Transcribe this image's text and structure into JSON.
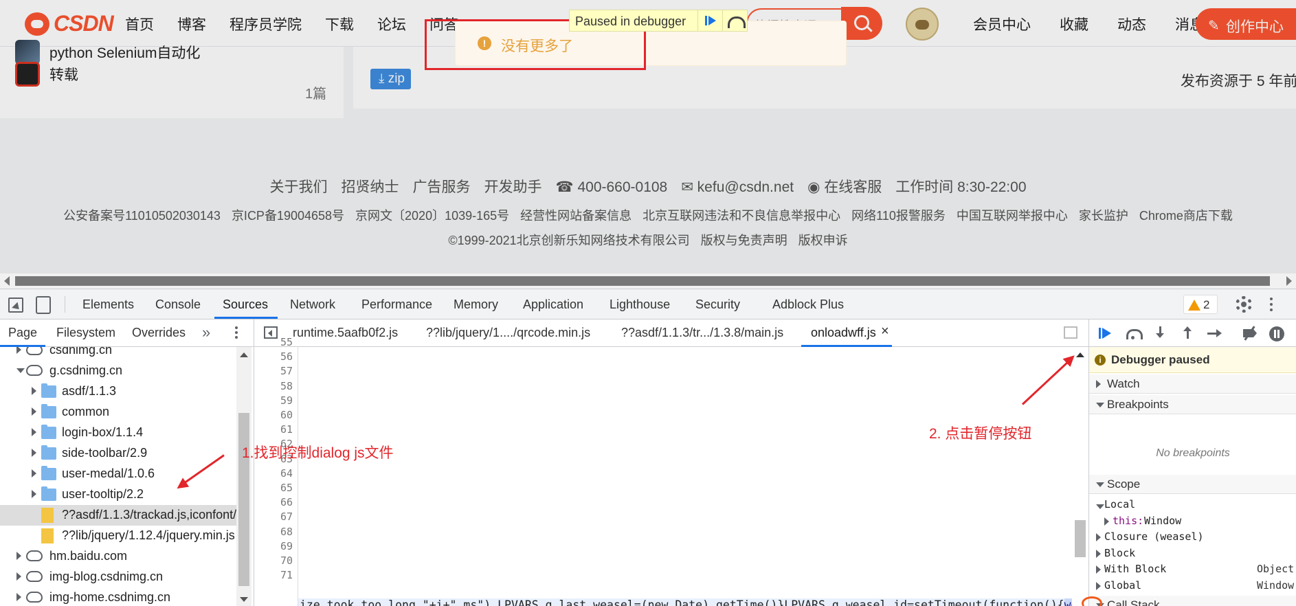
{
  "site": {
    "logo_text": "CSDN",
    "nav": [
      "首页",
      "博客",
      "程序员学院",
      "下载",
      "论坛",
      "问答"
    ],
    "search_placeholder": "热门搜索词",
    "nav_right": [
      "会员中心",
      "收藏",
      "动态",
      "消息"
    ],
    "create_button": "创作中心",
    "create_icon": "pen-icon",
    "paused_label": "Paused in debugger",
    "toast_text": "没有更多了",
    "toast_icon": "!",
    "sidebar_items": [
      {
        "label": "python Selenium自动化",
        "count": ""
      },
      {
        "label": "转载",
        "count": "1篇"
      }
    ],
    "zip_label": "zip",
    "zip_icon": "⤓",
    "publish_text": "发布资源于 5 年前",
    "footer_row1": [
      "关于我们",
      "招贤纳士",
      "广告服务",
      "开发助手",
      "☎ 400-660-0108",
      "✉ kefu@csdn.net",
      "◉ 在线客服",
      "工作时间 8:30-22:00"
    ],
    "footer_row2": [
      "公安备案号11010502030143",
      "京ICP备19004658号",
      "京网文〔2020〕1039-165号",
      "经营性网站备案信息",
      "北京互联网违法和不良信息举报中心",
      "网络110报警服务",
      "中国互联网举报中心",
      "家长监护",
      "Chrome商店下载"
    ],
    "footer_row3": [
      "©1999-2021北京创新乐知网络技术有限公司",
      "版权与免责声明",
      "版权申诉"
    ]
  },
  "devtools": {
    "tabs": [
      "Elements",
      "Console",
      "Sources",
      "Network",
      "Performance",
      "Memory",
      "Application",
      "Lighthouse",
      "Security",
      "Adblock Plus"
    ],
    "active_tab": "Sources",
    "warning_count": "2",
    "navigator_tabs": [
      "Page",
      "Filesystem",
      "Overrides"
    ],
    "more_tabs": "»",
    "tree": [
      {
        "label": "csdnimg.cn",
        "type": "cloud",
        "arrow": "r",
        "indent": 0
      },
      {
        "label": "g.csdnimg.cn",
        "type": "cloud",
        "arrow": "d",
        "indent": 0
      },
      {
        "label": "asdf/1.1.3",
        "type": "folder",
        "arrow": "r",
        "indent": 1
      },
      {
        "label": "common",
        "type": "folder",
        "arrow": "r",
        "indent": 1
      },
      {
        "label": "login-box/1.1.4",
        "type": "folder",
        "arrow": "r",
        "indent": 1
      },
      {
        "label": "side-toolbar/2.9",
        "type": "folder",
        "arrow": "r",
        "indent": 1
      },
      {
        "label": "user-medal/1.0.6",
        "type": "folder",
        "arrow": "r",
        "indent": 1
      },
      {
        "label": "user-tooltip/2.2",
        "type": "folder",
        "arrow": "r",
        "indent": 1
      },
      {
        "label": "??asdf/1.1.3/trackad.js,iconfont/",
        "type": "file",
        "arrow": "",
        "indent": 1,
        "selected": true
      },
      {
        "label": "??lib/jquery/1.12.4/jquery.min.js",
        "type": "file",
        "arrow": "",
        "indent": 1
      },
      {
        "label": "hm.baidu.com",
        "type": "cloud",
        "arrow": "r",
        "indent": 0
      },
      {
        "label": "img-blog.csdnimg.cn",
        "type": "cloud",
        "arrow": "r",
        "indent": 0
      },
      {
        "label": "img-home.csdnimg.cn",
        "type": "cloud",
        "arrow": "r",
        "indent": 0
      }
    ],
    "editor_tabs": [
      "runtime.5aafb0f2.js",
      "??lib/jquery/1..../qrcode.min.js",
      "??asdf/1.1.3/tr.../1.3.8/main.js",
      "onloadwff.js"
    ],
    "active_editor_tab": "onloadwff.js",
    "close_glyph": "×",
    "line_numbers": [
      "55",
      "56",
      "57",
      "58",
      "59",
      "60",
      "61",
      "62",
      "63",
      "64",
      "65",
      "66",
      "67",
      "68",
      "69",
      "70",
      "71"
    ],
    "code_line": "ize took too long \"+i+\" ms\"),LPVARS.g_last_weasel=(new Date).getTime()}LPVARS.g_weasel_id=setTimeout(function(){",
    "code_sel": "we",
    "annotation_1": "1.找到控制dialog js文件",
    "annotation_2": "2. 点击暂停按钮",
    "debugger": {
      "paused_banner": "Debugger paused",
      "sections": [
        "Watch",
        "Breakpoints"
      ],
      "no_breakpoints": "No breakpoints",
      "scope_title": "Scope",
      "scope": [
        {
          "key": "Local",
          "value": "",
          "arrow": "d",
          "indent": 0
        },
        {
          "key": "this",
          "value": "Window",
          "arrow": "r",
          "indent": 1
        },
        {
          "key": "Closure (weasel)",
          "value": "",
          "arrow": "r",
          "indent": 0
        },
        {
          "key": "Block",
          "value": "",
          "arrow": "r",
          "indent": 0
        },
        {
          "key": "With Block",
          "value": "Object",
          "arrow": "r",
          "indent": 0
        },
        {
          "key": "Global",
          "value": "Window",
          "arrow": "r",
          "indent": 0
        }
      ],
      "call_stack": "Call Stack"
    }
  }
}
